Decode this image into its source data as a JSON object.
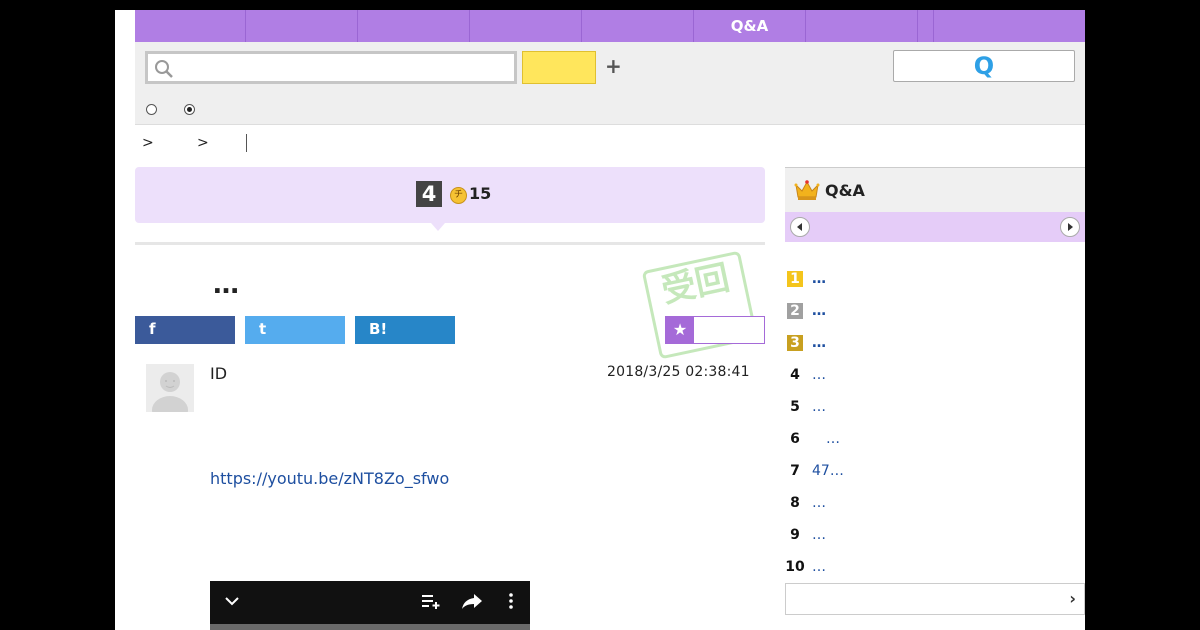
{
  "nav": {
    "tabs": [
      {
        "label": ""
      },
      {
        "label": ""
      },
      {
        "label": ""
      },
      {
        "label": ""
      },
      {
        "label": ""
      },
      {
        "label": "Q&A"
      },
      {
        "label": ""
      },
      {
        "label": ""
      },
      {
        "label": ""
      }
    ]
  },
  "search": {
    "placeholder": "",
    "yellow_label": "",
    "plus_label": "+",
    "q_label": "Q",
    "radio_selected_index": 1
  },
  "breadcrumb": {
    "sep1": ">",
    "sep2": ">"
  },
  "question": {
    "points_rank": "4",
    "coin_glyph": "チ",
    "points_value": "15",
    "stamp_text": "受回",
    "title": "…",
    "share": {
      "facebook": "f",
      "twitter": "t",
      "hatena": "B!"
    },
    "favorite_star": "★",
    "favorite_label": "",
    "user_id": "ID",
    "timestamp": "2018/3/25  02:38:41",
    "link": "https://youtu.be/zNT8Zo_sfwo"
  },
  "ranking": {
    "title": "Q&A",
    "items": [
      {
        "rank": "1",
        "text": "…"
      },
      {
        "rank": "2",
        "text": "…"
      },
      {
        "rank": "3",
        "text": "…"
      },
      {
        "rank": "4",
        "text": "…"
      },
      {
        "rank": "5",
        "text": "…"
      },
      {
        "rank": "6",
        "text": "　…"
      },
      {
        "rank": "7",
        "text": "47…"
      },
      {
        "rank": "8",
        "text": "…"
      },
      {
        "rank": "9",
        "text": "…"
      },
      {
        "rank": "10",
        "text": "…"
      }
    ],
    "more_arrow": "›"
  },
  "colors": {
    "nav": "#b07ee4",
    "facebook": "#3b5a9a",
    "twitter": "#55acee",
    "hatena": "#2786c8",
    "accent": "#a56ad8"
  }
}
